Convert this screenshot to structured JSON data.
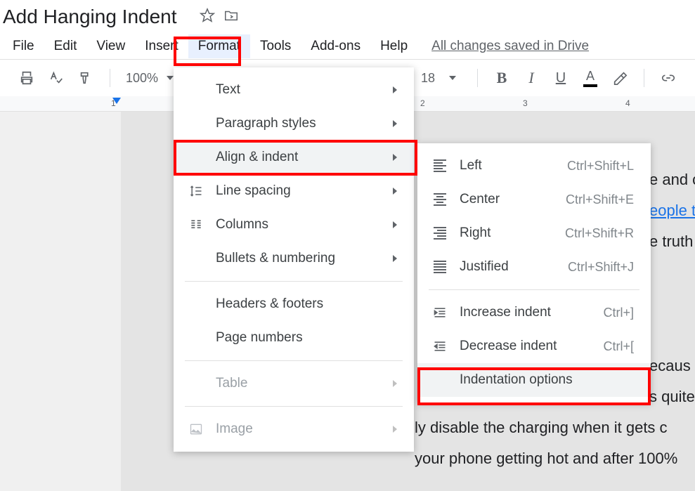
{
  "doc_title": "Add Hanging Indent",
  "menubar": {
    "file": "File",
    "edit": "Edit",
    "view": "View",
    "insert": "Insert",
    "format": "Format",
    "tools": "Tools",
    "addons": "Add-ons",
    "help": "Help",
    "saved": "All changes saved in Drive"
  },
  "toolbar": {
    "zoom": "100%",
    "font_size": "18",
    "bold": "B",
    "italic": "I",
    "underline": "U",
    "color_letter": "A"
  },
  "ruler_numbers": [
    "1",
    "2",
    "3",
    "4"
  ],
  "format_menu": {
    "text": "Text",
    "paragraph_styles": "Paragraph styles",
    "align_indent": "Align & indent",
    "line_spacing": "Line spacing",
    "columns": "Columns",
    "bullets": "Bullets & numbering",
    "headers_footers": "Headers & footers",
    "page_numbers": "Page numbers",
    "table": "Table",
    "image": "Image"
  },
  "align_submenu": {
    "left": {
      "label": "Left",
      "shortcut": "Ctrl+Shift+L"
    },
    "center": {
      "label": "Center",
      "shortcut": "Ctrl+Shift+E"
    },
    "right": {
      "label": "Right",
      "shortcut": "Ctrl+Shift+R"
    },
    "justified": {
      "label": "Justified",
      "shortcut": "Ctrl+Shift+J"
    },
    "increase": {
      "label": "Increase indent",
      "shortcut": "Ctrl+]"
    },
    "decrease": {
      "label": "Decrease indent",
      "shortcut": "Ctrl+["
    },
    "options": {
      "label": "Indentation options"
    }
  },
  "doc_snippets": {
    "l1": "e and c",
    "l2": "eople t",
    "l3": "e truth",
    "l4": "ecaus",
    "l5": "s quite",
    "l6": "ly disable the charging when it gets c",
    "l7": "your phone getting hot and after 100%"
  }
}
